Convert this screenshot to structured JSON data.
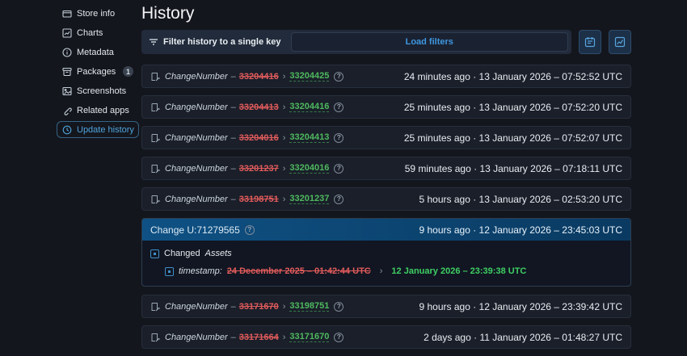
{
  "sidebar": {
    "items": [
      {
        "label": "Store info",
        "icon": "store-icon",
        "active": false,
        "badge": null
      },
      {
        "label": "Charts",
        "icon": "chart-icon",
        "active": false,
        "badge": null
      },
      {
        "label": "Metadata",
        "icon": "info-icon",
        "active": false,
        "badge": null
      },
      {
        "label": "Packages",
        "icon": "package-icon",
        "active": false,
        "badge": "1"
      },
      {
        "label": "Screenshots",
        "icon": "image-icon",
        "active": false,
        "badge": null
      },
      {
        "label": "Related apps",
        "icon": "link-icon",
        "active": false,
        "badge": null
      },
      {
        "label": "Update history",
        "icon": "history-clock-icon",
        "active": true,
        "badge": null
      }
    ]
  },
  "header": {
    "title": "History"
  },
  "filter_bar": {
    "label": "Filter history to a single key",
    "load_button": "Load filters",
    "calendar_button_icon": "calendar-icon",
    "chart_button_icon": "line-chart-icon"
  },
  "history": {
    "entries": [
      {
        "type": "simple",
        "field": "ChangeNumber",
        "dash": "–",
        "old": "33204416",
        "new": "33204425",
        "time": "24 minutes ago · 13 January 2026 – 07:52:52 UTC"
      },
      {
        "type": "simple",
        "field": "ChangeNumber",
        "dash": "–",
        "old": "33204413",
        "new": "33204416",
        "time": "25 minutes ago · 13 January 2026 – 07:52:20 UTC"
      },
      {
        "type": "simple",
        "field": "ChangeNumber",
        "dash": "–",
        "old": "33204016",
        "new": "33204413",
        "time": "25 minutes ago · 13 January 2026 – 07:52:07 UTC"
      },
      {
        "type": "simple",
        "field": "ChangeNumber",
        "dash": "–",
        "old": "33201237",
        "new": "33204016",
        "time": "59 minutes ago · 13 January 2026 – 07:18:11 UTC"
      },
      {
        "type": "simple",
        "field": "ChangeNumber",
        "dash": "–",
        "old": "33198751",
        "new": "33201237",
        "time": "5 hours ago · 13 January 2026 – 02:53:20 UTC"
      },
      {
        "type": "detailed",
        "title": "Change U:71279565",
        "time": "9 hours ago · 12 January 2026 – 23:45:03 UTC",
        "changed_word": "Changed",
        "changed_target": "Assets",
        "diff_key": "timestamp:",
        "old_value": "24 December 2025 – 01:42:44 UTC",
        "new_value": "12 January 2026 – 23:39:38 UTC",
        "separator": "›"
      },
      {
        "type": "simple",
        "field": "ChangeNumber",
        "dash": "–",
        "old": "33171670",
        "new": "33198751",
        "time": "9 hours ago · 12 January 2026 – 23:39:42 UTC"
      },
      {
        "type": "simple",
        "field": "ChangeNumber",
        "dash": "–",
        "old": "33171664",
        "new": "33171670",
        "time": "2 days ago · 11 January 2026 – 01:48:27 UTC"
      }
    ],
    "separator": "›",
    "help_glyph": "?"
  },
  "colors": {
    "background": "#14161d",
    "row_background": "#1a1f2a",
    "accent_blue": "#4ea4dd",
    "removed_red": "#e15b5b",
    "added_green": "#4eb95e",
    "change_header_gradient_start": "#0f5184",
    "change_header_gradient_end": "#0a3a61"
  }
}
